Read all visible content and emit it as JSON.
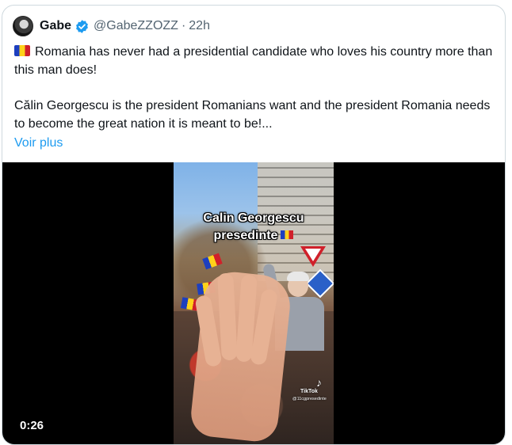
{
  "tweet": {
    "author_name": "Gabe",
    "handle": "@GabeZZOZZ",
    "separator": "·",
    "time": "22h",
    "line1": "Romania has never had a presidential candidate who loves his country more than this man does!",
    "line2": "Călin Georgescu is the president Romanians want and the president Romania needs to become the great nation it is meant to be!...",
    "see_more": "Voir plus"
  },
  "video": {
    "caption_line1": "Calin Georgescu",
    "caption_line2": "presedinte",
    "watermark_brand": "TikTok",
    "watermark_user": "@11cgpresedinte",
    "duration": "0:26"
  },
  "icons": {
    "verified": "verified-badge-icon",
    "flag": "romania-flag-icon",
    "tiktok": "tiktok-icon"
  },
  "colors": {
    "link": "#1d9bf0",
    "verified": "#1d9bf0",
    "muted": "#536471",
    "border": "#cfd9de"
  }
}
